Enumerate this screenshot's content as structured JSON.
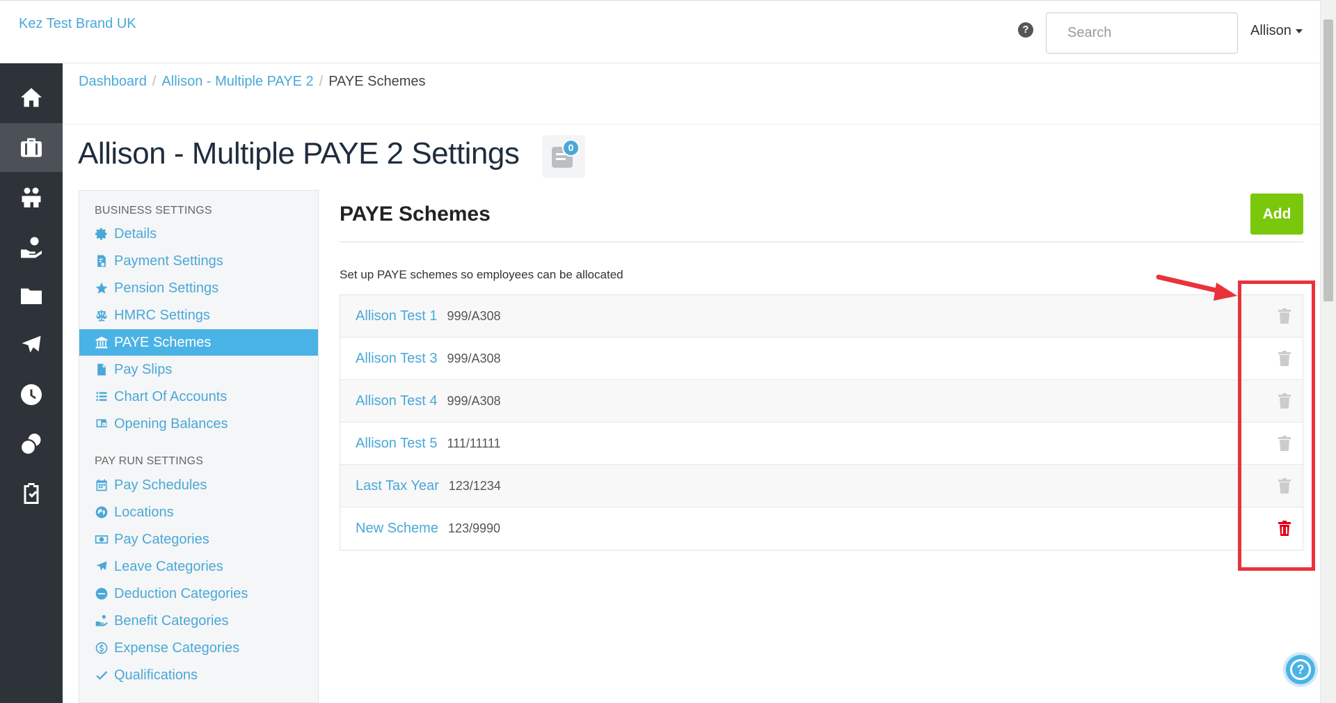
{
  "brand": {
    "name": "Kez Test Brand UK"
  },
  "header": {
    "search_placeholder": "Search",
    "user_name": "Allison",
    "help_glyph": "?"
  },
  "breadcrumb": {
    "items": [
      "Dashboard",
      "Allison - Multiple PAYE 2"
    ],
    "separator": "/",
    "current": "PAYE Schemes"
  },
  "page": {
    "title": "Allison - Multiple PAYE 2 Settings",
    "notes_count": "0"
  },
  "nav": {
    "items": [
      {
        "icon": "home-icon",
        "active": false
      },
      {
        "icon": "briefcase-icon",
        "active": true
      },
      {
        "icon": "people-icon",
        "active": false
      },
      {
        "icon": "hand-coin-icon",
        "active": false
      },
      {
        "icon": "folder-icon",
        "active": false
      },
      {
        "icon": "plane-icon",
        "active": false
      },
      {
        "icon": "clock-icon",
        "active": false
      },
      {
        "icon": "coins-icon",
        "active": false
      },
      {
        "icon": "clipboard-check-icon",
        "active": false
      }
    ]
  },
  "settings": {
    "business_heading": "BUSINESS SETTINGS",
    "business_items": [
      {
        "label": "Details",
        "icon": "gear-icon"
      },
      {
        "label": "Payment Settings",
        "icon": "payment-icon"
      },
      {
        "label": "Pension Settings",
        "icon": "star-icon"
      },
      {
        "label": "HMRC Settings",
        "icon": "scales-icon"
      },
      {
        "label": "PAYE Schemes",
        "icon": "bank-icon",
        "active": true
      },
      {
        "label": "Pay Slips",
        "icon": "file-icon"
      },
      {
        "label": "Chart Of Accounts",
        "icon": "list-icon"
      },
      {
        "label": "Opening Balances",
        "icon": "wallet-icon"
      }
    ],
    "payrun_heading": "PAY RUN SETTINGS",
    "payrun_items": [
      {
        "label": "Pay Schedules",
        "icon": "calendar-icon"
      },
      {
        "label": "Locations",
        "icon": "globe-icon"
      },
      {
        "label": "Pay Categories",
        "icon": "money-icon"
      },
      {
        "label": "Leave Categories",
        "icon": "plane-icon"
      },
      {
        "label": "Deduction Categories",
        "icon": "minus-circle-icon"
      },
      {
        "label": "Benefit Categories",
        "icon": "benefit-icon"
      },
      {
        "label": "Expense Categories",
        "icon": "dollar-icon"
      },
      {
        "label": "Qualifications",
        "icon": "check-icon"
      }
    ]
  },
  "main": {
    "section_title": "PAYE Schemes",
    "add_label": "Add",
    "description": "Set up PAYE schemes so employees can be allocated",
    "schemes": [
      {
        "name": "Allison Test 1",
        "ref": "999/A308",
        "deletable": false
      },
      {
        "name": "Allison Test 3",
        "ref": "999/A308",
        "deletable": false
      },
      {
        "name": "Allison Test 4",
        "ref": "999/A308",
        "deletable": false
      },
      {
        "name": "Allison Test 5",
        "ref": "111/11111",
        "deletable": false
      },
      {
        "name": "Last Tax Year",
        "ref": "123/1234",
        "deletable": false
      },
      {
        "name": "New Scheme",
        "ref": "123/9990",
        "deletable": true
      }
    ]
  },
  "colors": {
    "accent": "#4aa8d8",
    "add_button": "#7ac70c",
    "nav_bg": "#2d3338",
    "trash_disabled": "#cccccc",
    "trash_active": "#e2001a",
    "annotation": "#e8333b"
  }
}
